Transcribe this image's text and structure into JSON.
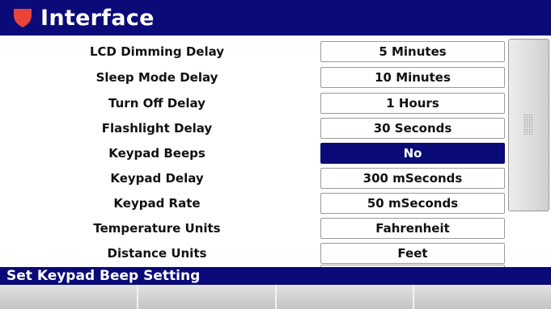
{
  "header": {
    "title": "Interface",
    "icon": "shield-icon",
    "icon_color": "#e8443a",
    "background": "#0a0a78"
  },
  "settings": [
    {
      "label": "LCD Dimming Delay",
      "value": "5 Minutes"
    },
    {
      "label": "Sleep Mode Delay",
      "value": "10 Minutes"
    },
    {
      "label": "Turn Off Delay",
      "value": "1 Hours"
    },
    {
      "label": "Flashlight Delay",
      "value": "30 Seconds"
    },
    {
      "label": "Keypad Beeps",
      "value": "No",
      "selected": true
    },
    {
      "label": "Keypad Delay",
      "value": "300 mSeconds"
    },
    {
      "label": "Keypad Rate",
      "value": "50 mSeconds"
    },
    {
      "label": "Temperature Units",
      "value": "Fahrenheit"
    },
    {
      "label": "Distance Units",
      "value": "Feet"
    }
  ],
  "status_bar": {
    "text": "Set Keypad Beep Setting"
  },
  "softkeys": [
    {
      "label": ""
    },
    {
      "label": ""
    },
    {
      "label": ""
    },
    {
      "label": ""
    }
  ],
  "colors": {
    "accent": "#0a0a78",
    "selected_value_bg": "#0a0a78",
    "selected_value_text": "#ffffff"
  }
}
